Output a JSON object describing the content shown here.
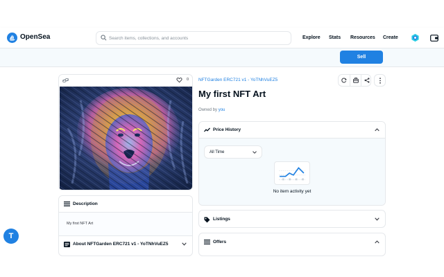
{
  "app": {
    "brand": "OpenSea",
    "accent_color": "#2081e2"
  },
  "nav": {
    "search_placeholder": "Search items, collections, and accounts",
    "links": [
      "Explore",
      "Stats",
      "Resources",
      "Create"
    ],
    "icons": [
      "account-icon",
      "wallet-icon"
    ]
  },
  "banner": {
    "sell_label": "Sell"
  },
  "item": {
    "collection": "NFTGarden ERC721 v1 - YoTNhVuEZ5",
    "title": "My first NFT Art",
    "owned_prefix": "Owned by",
    "owner": "you",
    "likes": "0",
    "image": "lion-artwork"
  },
  "actions": [
    "refresh-icon",
    "transfer-icon",
    "share-icon",
    "more-icon"
  ],
  "description": {
    "header": "Description",
    "text": "My first NFT Art"
  },
  "about": {
    "header": "About NFTGarden ERC721 v1 - YoTNhVuEZ5"
  },
  "price_history": {
    "header": "Price History",
    "range": "All Time",
    "empty_text": "No item activity yet"
  },
  "listings": {
    "header": "Listings"
  },
  "offers": {
    "header": "Offers"
  },
  "fab": {
    "label": "T"
  }
}
